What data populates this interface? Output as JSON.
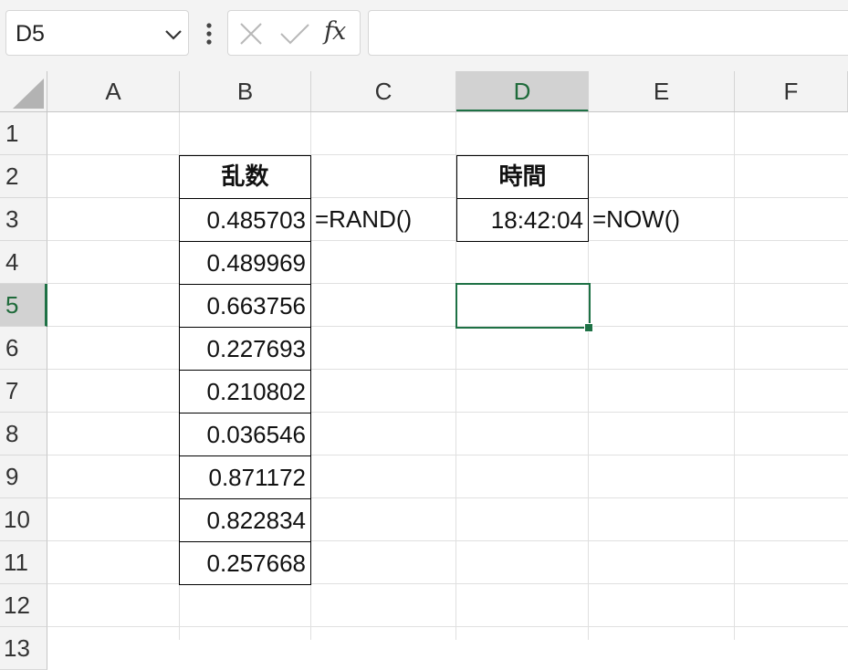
{
  "name_box": {
    "value": "D5"
  },
  "formula_bar": {
    "fx_label": "fx",
    "value": ""
  },
  "columns": [
    "A",
    "B",
    "C",
    "D",
    "E",
    "F"
  ],
  "rows": [
    "1",
    "2",
    "3",
    "4",
    "5",
    "6",
    "7",
    "8",
    "9",
    "10",
    "11",
    "12",
    "13"
  ],
  "active_cell": {
    "column": "D",
    "row": "5"
  },
  "cells": {
    "B2": "乱数",
    "B3": "0.485703",
    "B4": "0.489969",
    "B5": "0.663756",
    "B6": "0.227693",
    "B7": "0.210802",
    "B8": "0.036546",
    "B9": "0.871172",
    "B10": "0.822834",
    "B11": "0.257668",
    "C3": "=RAND()",
    "D2": "時間",
    "D3": "18:42:04",
    "E3": "=NOW()"
  },
  "colors": {
    "accent": "#1e7145",
    "header_bg": "#f3f3f3",
    "header_active_bg": "#d2d2d2"
  },
  "icons": [
    "chevron-down-icon",
    "more-dots-icon",
    "cancel-icon",
    "confirm-check-icon",
    "insert-function-icon",
    "select-all-icon"
  ]
}
